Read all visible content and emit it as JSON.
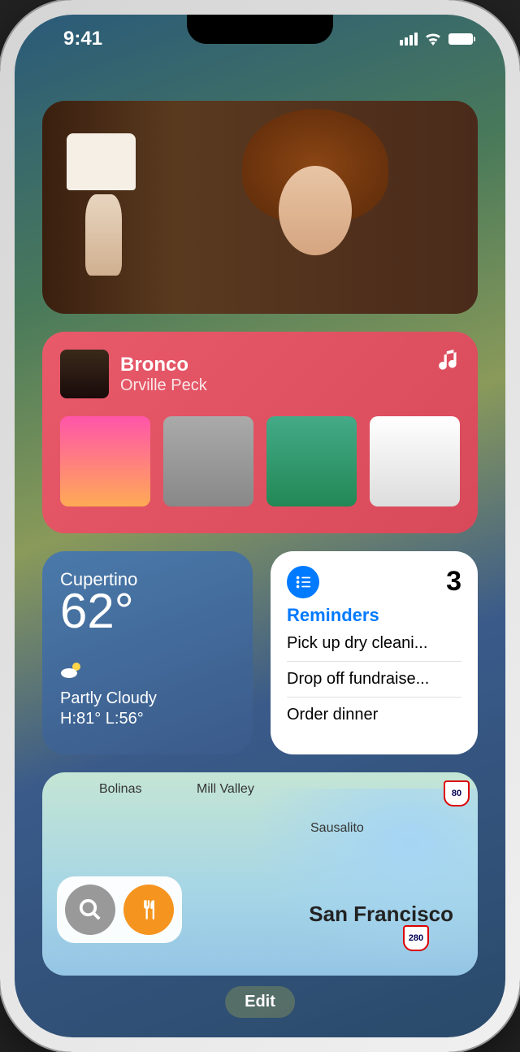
{
  "status": {
    "time": "9:41"
  },
  "music": {
    "title": "Bronco",
    "artist": "Orville Peck"
  },
  "weather": {
    "location": "Cupertino",
    "temp": "62°",
    "condition": "Partly Cloudy",
    "hilo": "H:81° L:56°"
  },
  "reminders": {
    "title": "Reminders",
    "count": "3",
    "items": [
      "Pick up dry cleani...",
      "Drop off fundraise...",
      "Order dinner"
    ]
  },
  "maps": {
    "main_city": "San Francisco",
    "labels": {
      "bolinas": "Bolinas",
      "mill_valley": "Mill Valley",
      "sausalito": "Sausalito"
    },
    "routes": {
      "i80": "80",
      "i280": "280"
    }
  },
  "edit_label": "Edit"
}
